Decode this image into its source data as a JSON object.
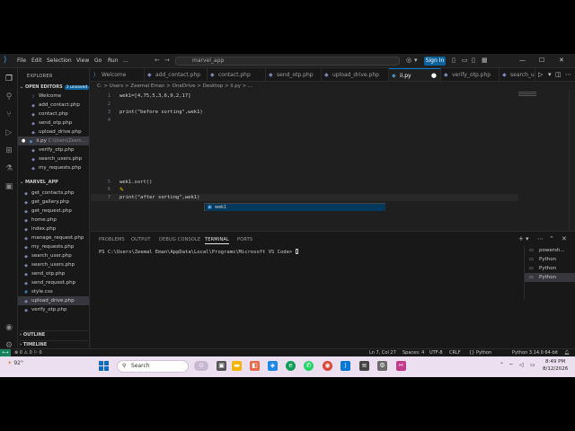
{
  "titlebar": {
    "menus": [
      "File",
      "Edit",
      "Selection",
      "View",
      "Go",
      "Run",
      "..."
    ],
    "search_text": "marvel_app",
    "signin": "Sign In"
  },
  "sidebar": {
    "header": "EXPLORER",
    "open_editors_label": "OPEN EDITORS",
    "unsaved_badge": "1 unsaved",
    "open_editors": [
      {
        "label": "Welcome",
        "icon": "vscode-icon",
        "path": ""
      },
      {
        "label": "add_contact.php",
        "icon": "php-icon",
        "path": ""
      },
      {
        "label": "contact.php",
        "icon": "php-icon",
        "path": ""
      },
      {
        "label": "send_otp.php",
        "icon": "php-icon",
        "path": ""
      },
      {
        "label": "upload_drive.php",
        "icon": "php-icon",
        "path": ""
      },
      {
        "label": "ii.py",
        "icon": "python-icon",
        "path": "C:\\Users\\Zeem..."
      },
      {
        "label": "verify_otp.php",
        "icon": "php-icon",
        "path": ""
      },
      {
        "label": "search_users.php",
        "icon": "php-icon",
        "path": ""
      },
      {
        "label": "my_requests.php",
        "icon": "php-icon",
        "path": ""
      }
    ],
    "folder_label": "MARVEL_APP",
    "folder_files": [
      {
        "label": "get_contacts.php",
        "icon": "php-icon"
      },
      {
        "label": "get_gallery.php",
        "icon": "php-icon"
      },
      {
        "label": "get_request.php",
        "icon": "php-icon"
      },
      {
        "label": "home.php",
        "icon": "php-icon"
      },
      {
        "label": "index.php",
        "icon": "php-icon"
      },
      {
        "label": "manage_request.php",
        "icon": "php-icon"
      },
      {
        "label": "my_requests.php",
        "icon": "php-icon"
      },
      {
        "label": "search_user.php",
        "icon": "php-icon"
      },
      {
        "label": "search_users.php",
        "icon": "php-icon"
      },
      {
        "label": "send_otp.php",
        "icon": "php-icon"
      },
      {
        "label": "send_request.php",
        "icon": "php-icon"
      },
      {
        "label": "style.css",
        "icon": "css-icon"
      },
      {
        "label": "upload_drive.php",
        "icon": "php-icon"
      },
      {
        "label": "verify_otp.php",
        "icon": "php-icon"
      }
    ],
    "outline_label": "OUTLINE",
    "timeline_label": "TIMELINE"
  },
  "tabs": [
    {
      "label": "Welcome",
      "icon": "vscode-icon",
      "active": false
    },
    {
      "label": "add_contact.php",
      "icon": "php-icon",
      "active": false
    },
    {
      "label": "contact.php",
      "icon": "php-icon",
      "active": false
    },
    {
      "label": "send_otp.php",
      "icon": "php-icon",
      "active": false
    },
    {
      "label": "upload_drive.php",
      "icon": "php-icon",
      "active": false
    },
    {
      "label": "ii.py",
      "icon": "python-icon",
      "active": true
    },
    {
      "label": "verify_otp.php",
      "icon": "php-icon",
      "active": false
    },
    {
      "label": "search_u",
      "icon": "php-icon",
      "active": false
    }
  ],
  "breadcrumb": "C: > Users > Zeemal Eman > OneDrive > Desktop > ii.py > ...",
  "editor": {
    "lines": [
      {
        "num": "1",
        "text": "wek1=[4,75,5,3,6,9,2,17]"
      },
      {
        "num": "2",
        "text": ""
      },
      {
        "num": "3",
        "text": "print(\"before sorting\",wek1)"
      },
      {
        "num": "4",
        "text": ""
      },
      {
        "num": "5",
        "text": "wek1.sort()"
      },
      {
        "num": "6",
        "text": ""
      },
      {
        "num": "7",
        "text": "print(\"after sorting\",wek1)"
      }
    ],
    "suggestion": "wek1"
  },
  "panel": {
    "tabs": [
      "PROBLEMS",
      "OUTPUT",
      "DEBUG CONSOLE",
      "TERMINAL",
      "PORTS"
    ],
    "active_tab": "TERMINAL",
    "terminal_text": "PS C:\\Users\\Zeemal Eman\\AppData\\Local\\Programs\\Microsoft VS Code> ",
    "terminals": [
      "powersh...",
      "Python",
      "Python",
      "Python"
    ]
  },
  "statusbar": {
    "left": "⊗ 0 ⚠ 0  ⚐ 0",
    "position": "Ln 7, Col 27",
    "spaces": "Spaces: 4",
    "encoding": "UTF-8",
    "eol": "CRLF",
    "language": "{} Python",
    "interpreter": "Python 3.14.0 64-bit"
  },
  "taskbar": {
    "weather": "92°",
    "search_placeholder": "Search",
    "time": "8:49 PM",
    "date": "8/12/2026"
  },
  "colors": {
    "editor_bg": "#1f1f1f",
    "sidebar_bg": "#181818",
    "accent": "#0078d4",
    "taskbar_bg": "#ecdff0"
  }
}
